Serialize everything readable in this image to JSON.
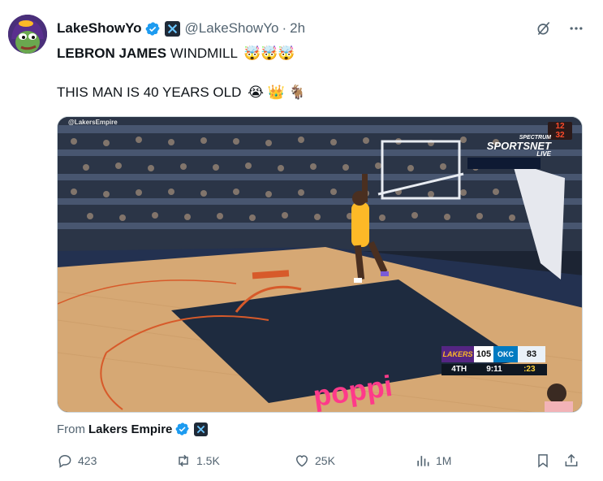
{
  "author": {
    "display_name": "LakeShowYo",
    "handle": "@LakeShowYo",
    "separator": "·",
    "time": "2h",
    "avatar_icon": "pepe-lakers-avatar",
    "verified_icon": "verified-badge-icon",
    "affiliate_icon": "x-affiliate-icon"
  },
  "tweet": {
    "line1_bold": "LEBRON JAMES",
    "line1_rest": " WINDMILL",
    "line1_emojis": "🤯🤯🤯",
    "line2_text": "THIS MAN IS 40 YEARS OLD",
    "line2_emojis": "😭 👑 🐐"
  },
  "media": {
    "watermark": "@LakersEmpire",
    "broadcaster_line1": "SPECTRUM",
    "broadcaster_line2": "SPORTSNET",
    "broadcaster_line3": "LIVE",
    "shot_clock_top": "12",
    "shot_clock_bottom": "32",
    "scoreboard": {
      "team1": "LAKERS",
      "team1_score": "105",
      "team2": "OKC",
      "team2_score": "83",
      "quarter": "4TH",
      "game_clock": "9:11",
      "shot_clock": ":23"
    },
    "floor_text": "poppi"
  },
  "from": {
    "label": "From",
    "source": "Lakers Empire"
  },
  "actions": {
    "replies": "423",
    "reposts": "1.5K",
    "likes": "25K",
    "views": "1M"
  },
  "colors": {
    "text_primary": "#0f1419",
    "text_secondary": "#536471",
    "verified_blue": "#1d9bf0",
    "lakers_purple": "#552583",
    "lakers_gold": "#fdb927"
  }
}
